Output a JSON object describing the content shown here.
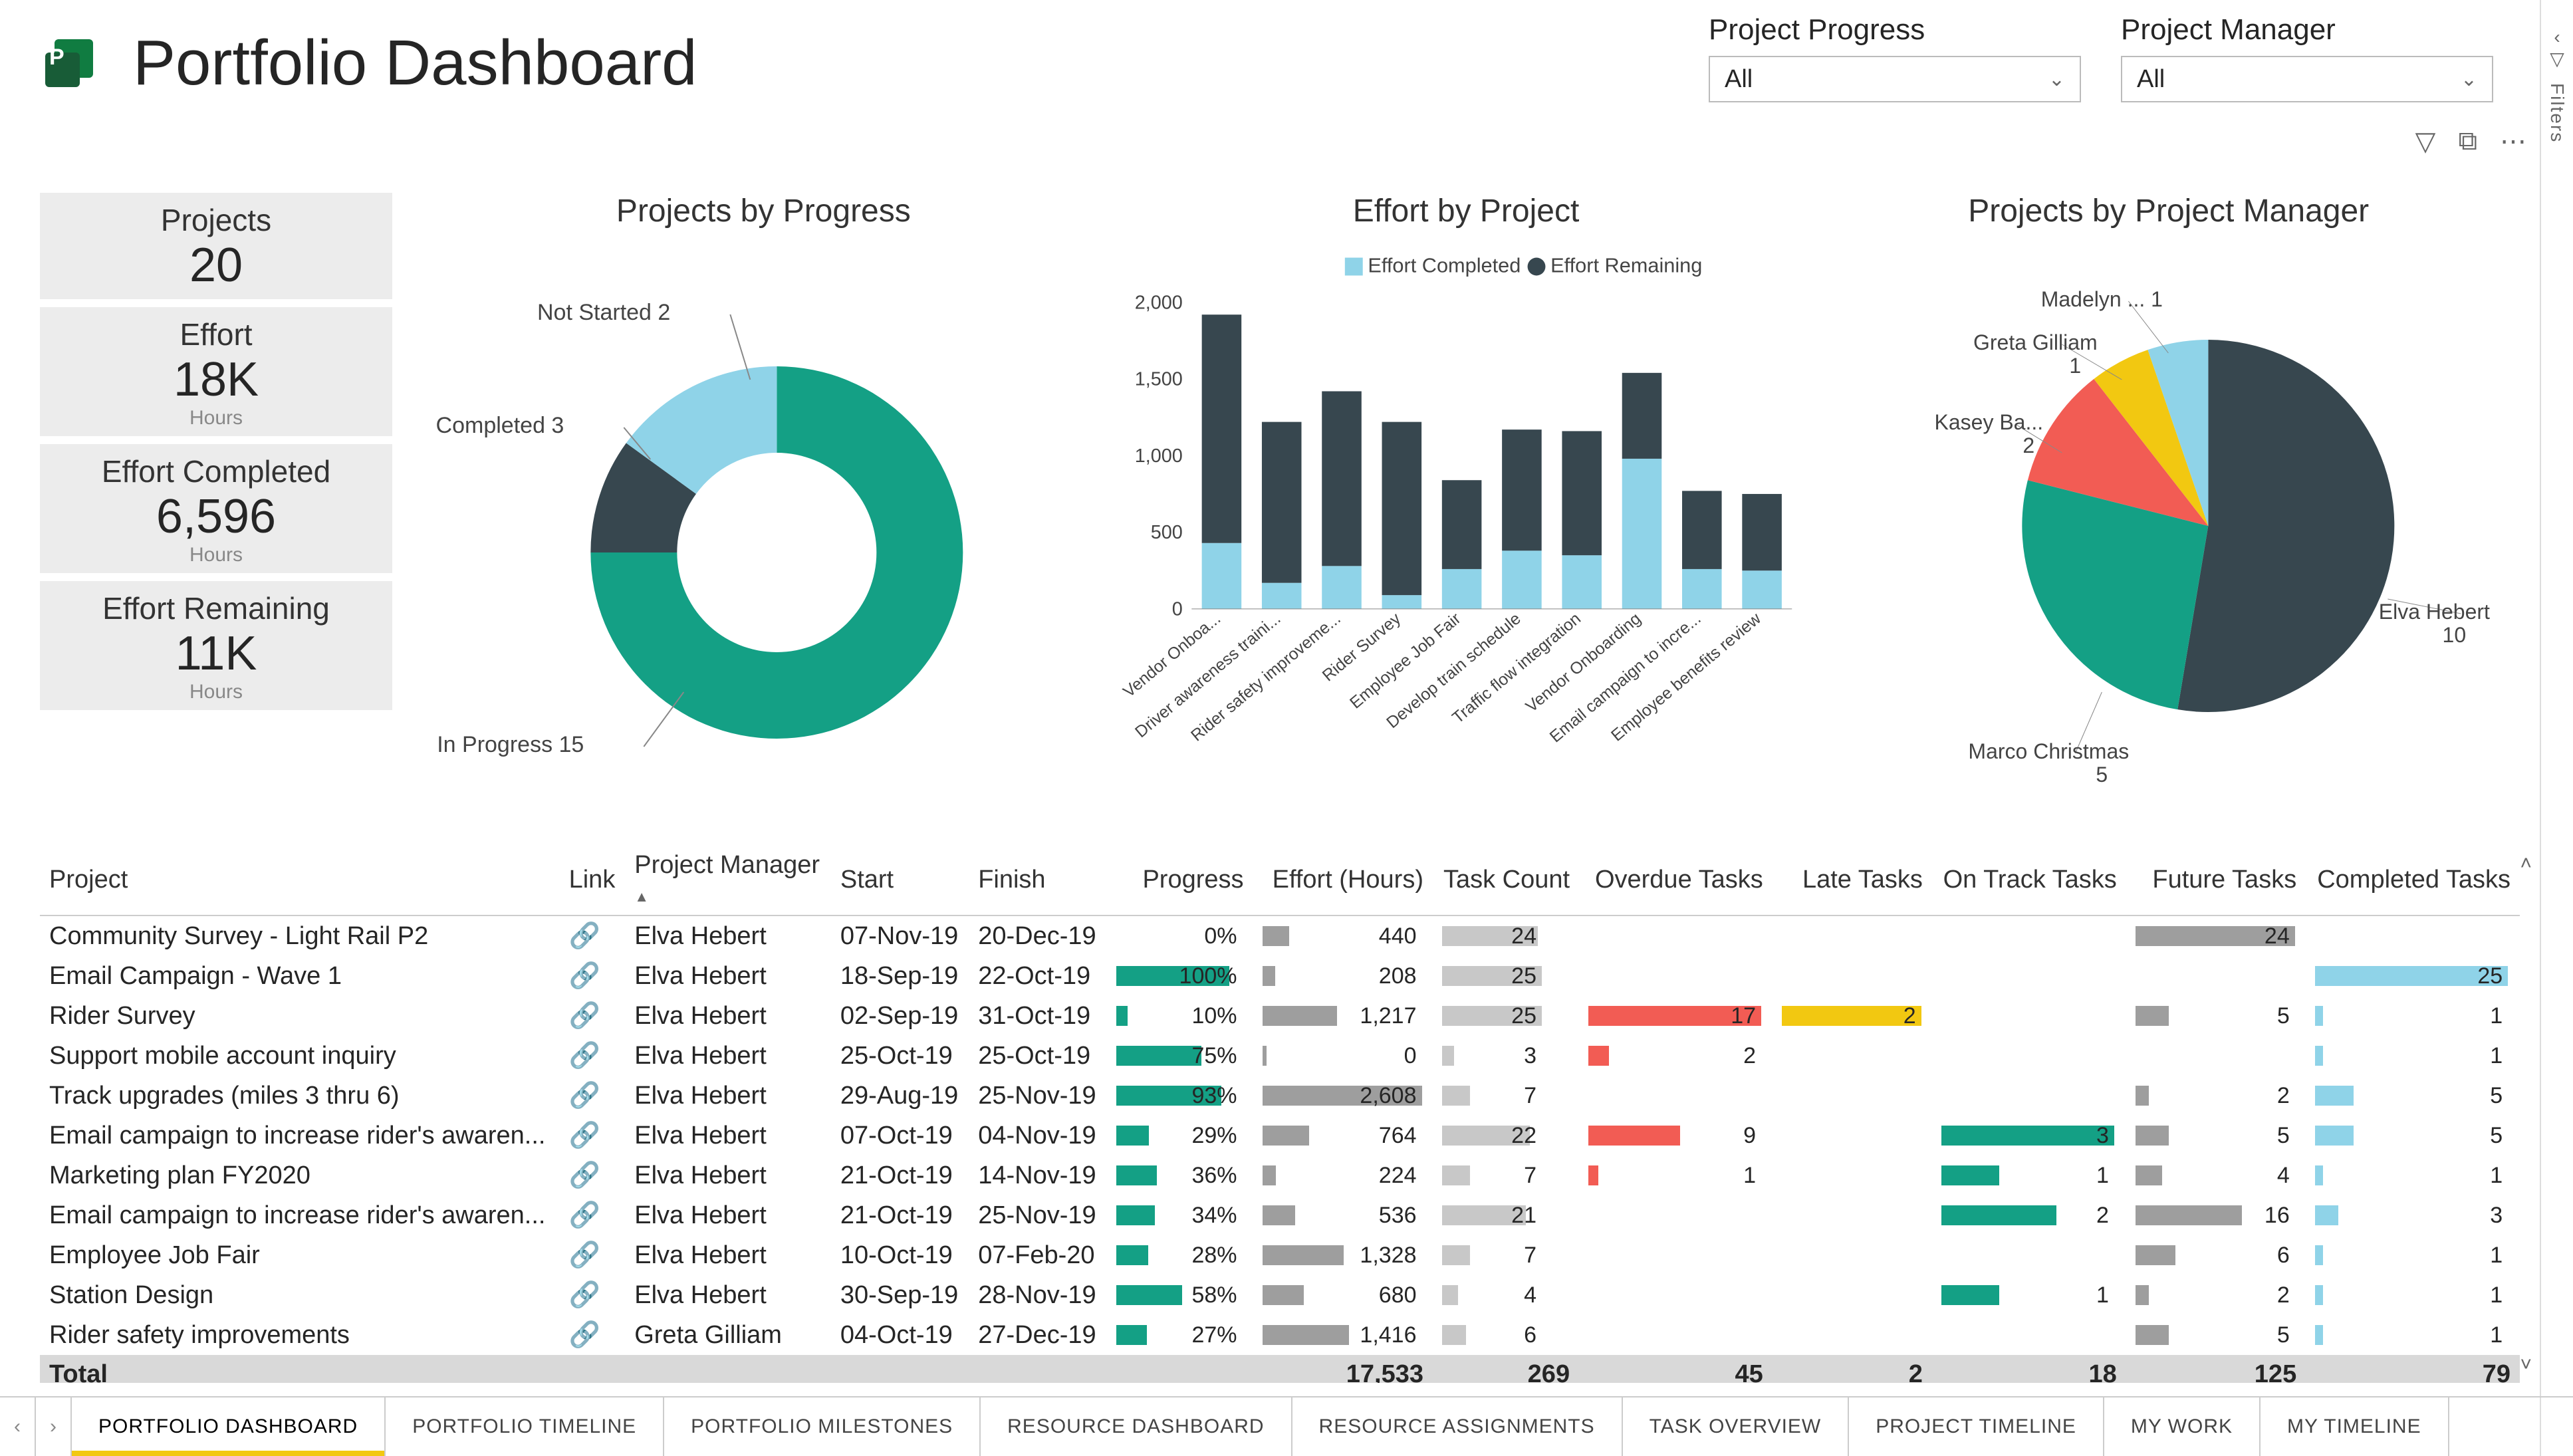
{
  "header": {
    "title": "Portfolio Dashboard"
  },
  "slicers": {
    "progress": {
      "label": "Project Progress",
      "value": "All"
    },
    "manager": {
      "label": "Project Manager",
      "value": "All"
    }
  },
  "filtersRail": {
    "label": "Filters"
  },
  "kpi": {
    "projects": {
      "label": "Projects",
      "value": "20"
    },
    "effort": {
      "label": "Effort",
      "value": "18K",
      "unit": "Hours"
    },
    "completed": {
      "label": "Effort Completed",
      "value": "6,596",
      "unit": "Hours"
    },
    "remaining": {
      "label": "Effort Remaining",
      "value": "11K",
      "unit": "Hours"
    }
  },
  "chart_data": [
    {
      "id": "projects_by_progress",
      "type": "pie",
      "title": "Projects by Progress",
      "series": [
        {
          "name": "In Progress",
          "value": 15,
          "color": "#14A085"
        },
        {
          "name": "Not Started",
          "value": 2,
          "color": "#37474F"
        },
        {
          "name": "Completed",
          "value": 3,
          "color": "#8FD3E8"
        }
      ],
      "donut": true
    },
    {
      "id": "effort_by_project",
      "type": "bar",
      "title": "Effort by Project",
      "legend": [
        "Effort Completed",
        "Effort Remaining"
      ],
      "ylim": [
        0,
        2000
      ],
      "yticks": [
        0,
        500,
        1000,
        1500,
        2000
      ],
      "categories": [
        "Vendor Onboa...",
        "Driver awareness traini...",
        "Rider safety improveme...",
        "Rider Survey",
        "Employee Job Fair",
        "Develop train schedule",
        "Traffic flow integration",
        "Vendor Onboarding",
        "Email campaign to incre...",
        "Employee benefits review"
      ],
      "series": [
        {
          "name": "Effort Completed",
          "color": "#8FD3E8",
          "values": [
            430,
            170,
            280,
            90,
            260,
            380,
            350,
            980,
            260,
            250
          ]
        },
        {
          "name": "Effort Remaining",
          "color": "#37474F",
          "values": [
            1490,
            1050,
            1140,
            1130,
            580,
            790,
            810,
            560,
            510,
            500
          ]
        }
      ]
    },
    {
      "id": "projects_by_pm",
      "type": "pie",
      "title": "Projects by Project Manager",
      "series": [
        {
          "name": "Elva Hebert",
          "value": 10,
          "color": "#37474F"
        },
        {
          "name": "Marco Christmas",
          "value": 5,
          "color": "#14A085"
        },
        {
          "name": "Kasey Ba...",
          "value": 2,
          "color": "#F25C54"
        },
        {
          "name": "Greta Gilliam",
          "value": 1,
          "color": "#F2C811"
        },
        {
          "name": "Madelyn ...",
          "value": 1,
          "color": "#8FD3E8"
        }
      ],
      "donut": false
    }
  ],
  "table": {
    "headers": [
      "Project",
      "Link",
      "Project Manager",
      "Start",
      "Finish",
      "Progress",
      "Effort (Hours)",
      "Task Count",
      "Overdue Tasks",
      "Late Tasks",
      "On Track Tasks",
      "Future Tasks",
      "Completed Tasks"
    ],
    "rows": [
      {
        "project": "Community Survey - Light Rail P2",
        "pm": "Elva Hebert",
        "start": "07-Nov-19",
        "finish": "20-Dec-19",
        "progress": 0,
        "effort": "440",
        "tasks": 24,
        "overdue": null,
        "late": null,
        "ontrack": null,
        "future": 24,
        "completed": null
      },
      {
        "project": "Email Campaign - Wave 1",
        "pm": "Elva Hebert",
        "start": "18-Sep-19",
        "finish": "22-Oct-19",
        "progress": 100,
        "effort": "208",
        "tasks": 25,
        "overdue": null,
        "late": null,
        "ontrack": null,
        "future": null,
        "completed": 25
      },
      {
        "project": "Rider Survey",
        "pm": "Elva Hebert",
        "start": "02-Sep-19",
        "finish": "31-Oct-19",
        "progress": 10,
        "effort": "1,217",
        "tasks": 25,
        "overdue": 17,
        "late": 2,
        "ontrack": null,
        "future": 5,
        "completed": 1
      },
      {
        "project": "Support mobile account inquiry",
        "pm": "Elva Hebert",
        "start": "25-Oct-19",
        "finish": "25-Oct-19",
        "progress": 75,
        "effort": "0",
        "tasks": 3,
        "overdue": 2,
        "late": null,
        "ontrack": null,
        "future": null,
        "completed": 1
      },
      {
        "project": "Track upgrades (miles 3 thru 6)",
        "pm": "Elva Hebert",
        "start": "29-Aug-19",
        "finish": "25-Nov-19",
        "progress": 93,
        "effort": "2,608",
        "tasks": 7,
        "overdue": null,
        "late": null,
        "ontrack": null,
        "future": 2,
        "completed": 5
      },
      {
        "project": "Email campaign to increase rider's awaren...",
        "pm": "Elva Hebert",
        "start": "07-Oct-19",
        "finish": "04-Nov-19",
        "progress": 29,
        "effort": "764",
        "tasks": 22,
        "overdue": 9,
        "late": null,
        "ontrack": 3,
        "future": 5,
        "completed": 5
      },
      {
        "project": "Marketing plan FY2020",
        "pm": "Elva Hebert",
        "start": "21-Oct-19",
        "finish": "14-Nov-19",
        "progress": 36,
        "effort": "224",
        "tasks": 7,
        "overdue": 1,
        "late": null,
        "ontrack": 1,
        "future": 4,
        "completed": 1
      },
      {
        "project": "Email campaign to increase rider's awaren...",
        "pm": "Elva Hebert",
        "start": "21-Oct-19",
        "finish": "25-Nov-19",
        "progress": 34,
        "effort": "536",
        "tasks": 21,
        "overdue": null,
        "late": null,
        "ontrack": 2,
        "future": 16,
        "completed": 3
      },
      {
        "project": "Employee Job Fair",
        "pm": "Elva Hebert",
        "start": "10-Oct-19",
        "finish": "07-Feb-20",
        "progress": 28,
        "effort": "1,328",
        "tasks": 7,
        "overdue": null,
        "late": null,
        "ontrack": null,
        "future": 6,
        "completed": 1
      },
      {
        "project": "Station Design",
        "pm": "Elva Hebert",
        "start": "30-Sep-19",
        "finish": "28-Nov-19",
        "progress": 58,
        "effort": "680",
        "tasks": 4,
        "overdue": null,
        "late": null,
        "ontrack": 1,
        "future": 2,
        "completed": 1
      },
      {
        "project": "Rider safety improvements",
        "pm": "Greta Gilliam",
        "start": "04-Oct-19",
        "finish": "27-Dec-19",
        "progress": 27,
        "effort": "1,416",
        "tasks": 6,
        "overdue": null,
        "late": null,
        "ontrack": null,
        "future": 5,
        "completed": 1
      }
    ],
    "totals": {
      "label": "Total",
      "effort": "17,533",
      "tasks": "269",
      "overdue": "45",
      "late": "2",
      "ontrack": "18",
      "future": "125",
      "completed": "79"
    }
  },
  "tabs": {
    "items": [
      "PORTFOLIO DASHBOARD",
      "PORTFOLIO TIMELINE",
      "PORTFOLIO MILESTONES",
      "RESOURCE DASHBOARD",
      "RESOURCE ASSIGNMENTS",
      "TASK OVERVIEW",
      "PROJECT TIMELINE",
      "MY WORK",
      "MY TIMELINE"
    ],
    "active": 0
  },
  "colors": {
    "teal": "#14A085",
    "dark": "#37474F",
    "sky": "#8FD3E8",
    "red": "#F25C54",
    "yellow": "#F2C811",
    "grey": "#9E9E9E"
  }
}
